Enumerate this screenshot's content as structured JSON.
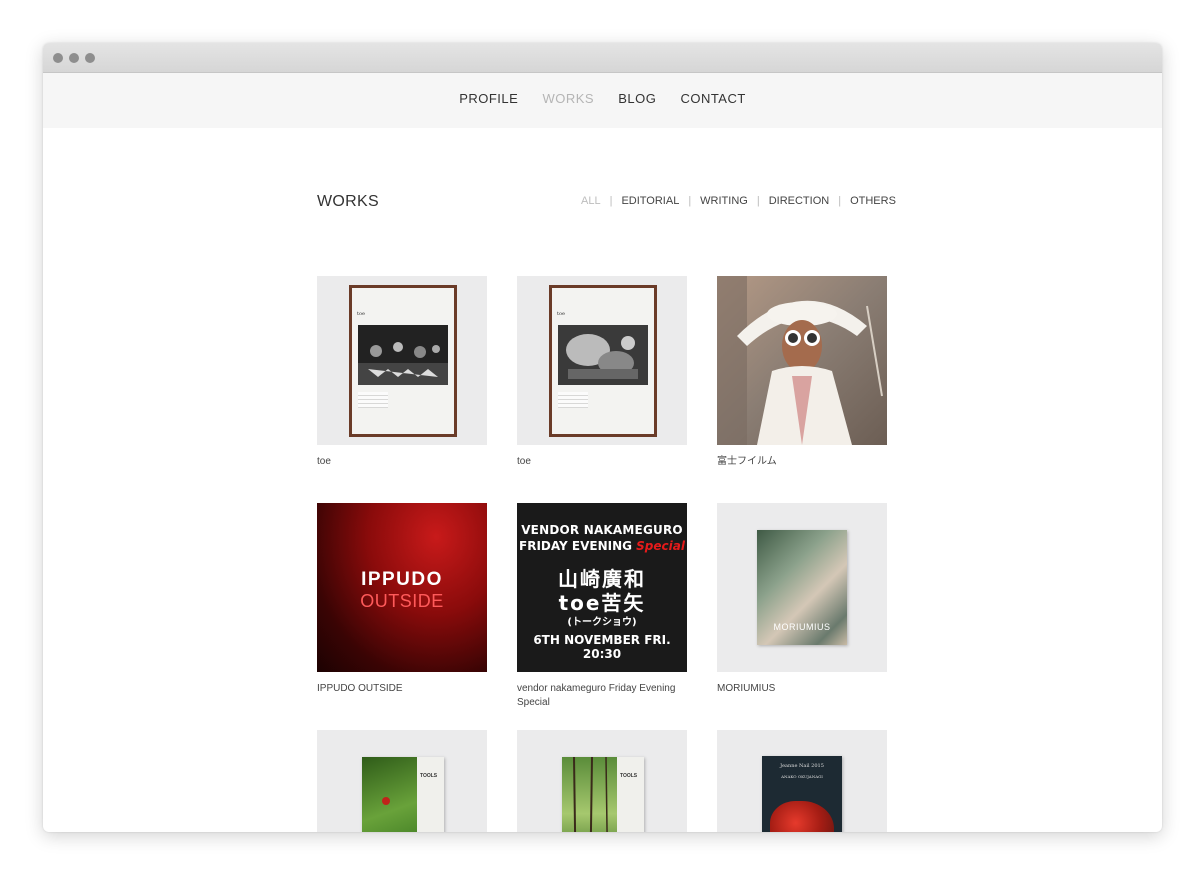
{
  "nav": {
    "items": [
      "PROFILE",
      "WORKS",
      "BLOG",
      "CONTACT"
    ],
    "active": "WORKS"
  },
  "page": {
    "title": "WORKS"
  },
  "filters": {
    "items": [
      "ALL",
      "EDITORIAL",
      "WRITING",
      "DIRECTION",
      "OTHERS"
    ],
    "active": "ALL"
  },
  "works": [
    {
      "caption": "toe",
      "poster_title": "toe"
    },
    {
      "caption": "toe",
      "poster_title": "toe"
    },
    {
      "caption": "富士フイルム"
    },
    {
      "caption": "IPPUDO OUTSIDE",
      "thumb_line1": "IPPUDO",
      "thumb_line2": "OUTSIDE"
    },
    {
      "caption": "vendor nakameguro Friday Evening Special",
      "thumb_line1": "VENDOR NAKAMEGURO",
      "thumb_line2": "FRIDAY EVENING",
      "thumb_line2_accent": "Special",
      "thumb_line3": "山崎廣和",
      "thumb_line4": "toe苦矢",
      "thumb_line5": "(トークショウ)",
      "thumb_line6": "6TH NOVEMBER FRI. 20:30"
    },
    {
      "caption": "MORIUMIUS",
      "cover_text": "MORIUMIUS"
    },
    {
      "caption": "",
      "cover_label": "TOOLS"
    },
    {
      "caption": "",
      "cover_label": "TOOLS"
    },
    {
      "caption": "",
      "cover_line1": "Jeanne Nail 2015",
      "cover_line2": "ANAKO OKUJANAGI"
    }
  ],
  "colors": {
    "nav_active": "#b5b5b5",
    "text": "#333333",
    "navbar_bg": "#f6f6f6",
    "ippudo_accent": "#ff5a5a",
    "vendor_accent": "#e61a1a"
  }
}
